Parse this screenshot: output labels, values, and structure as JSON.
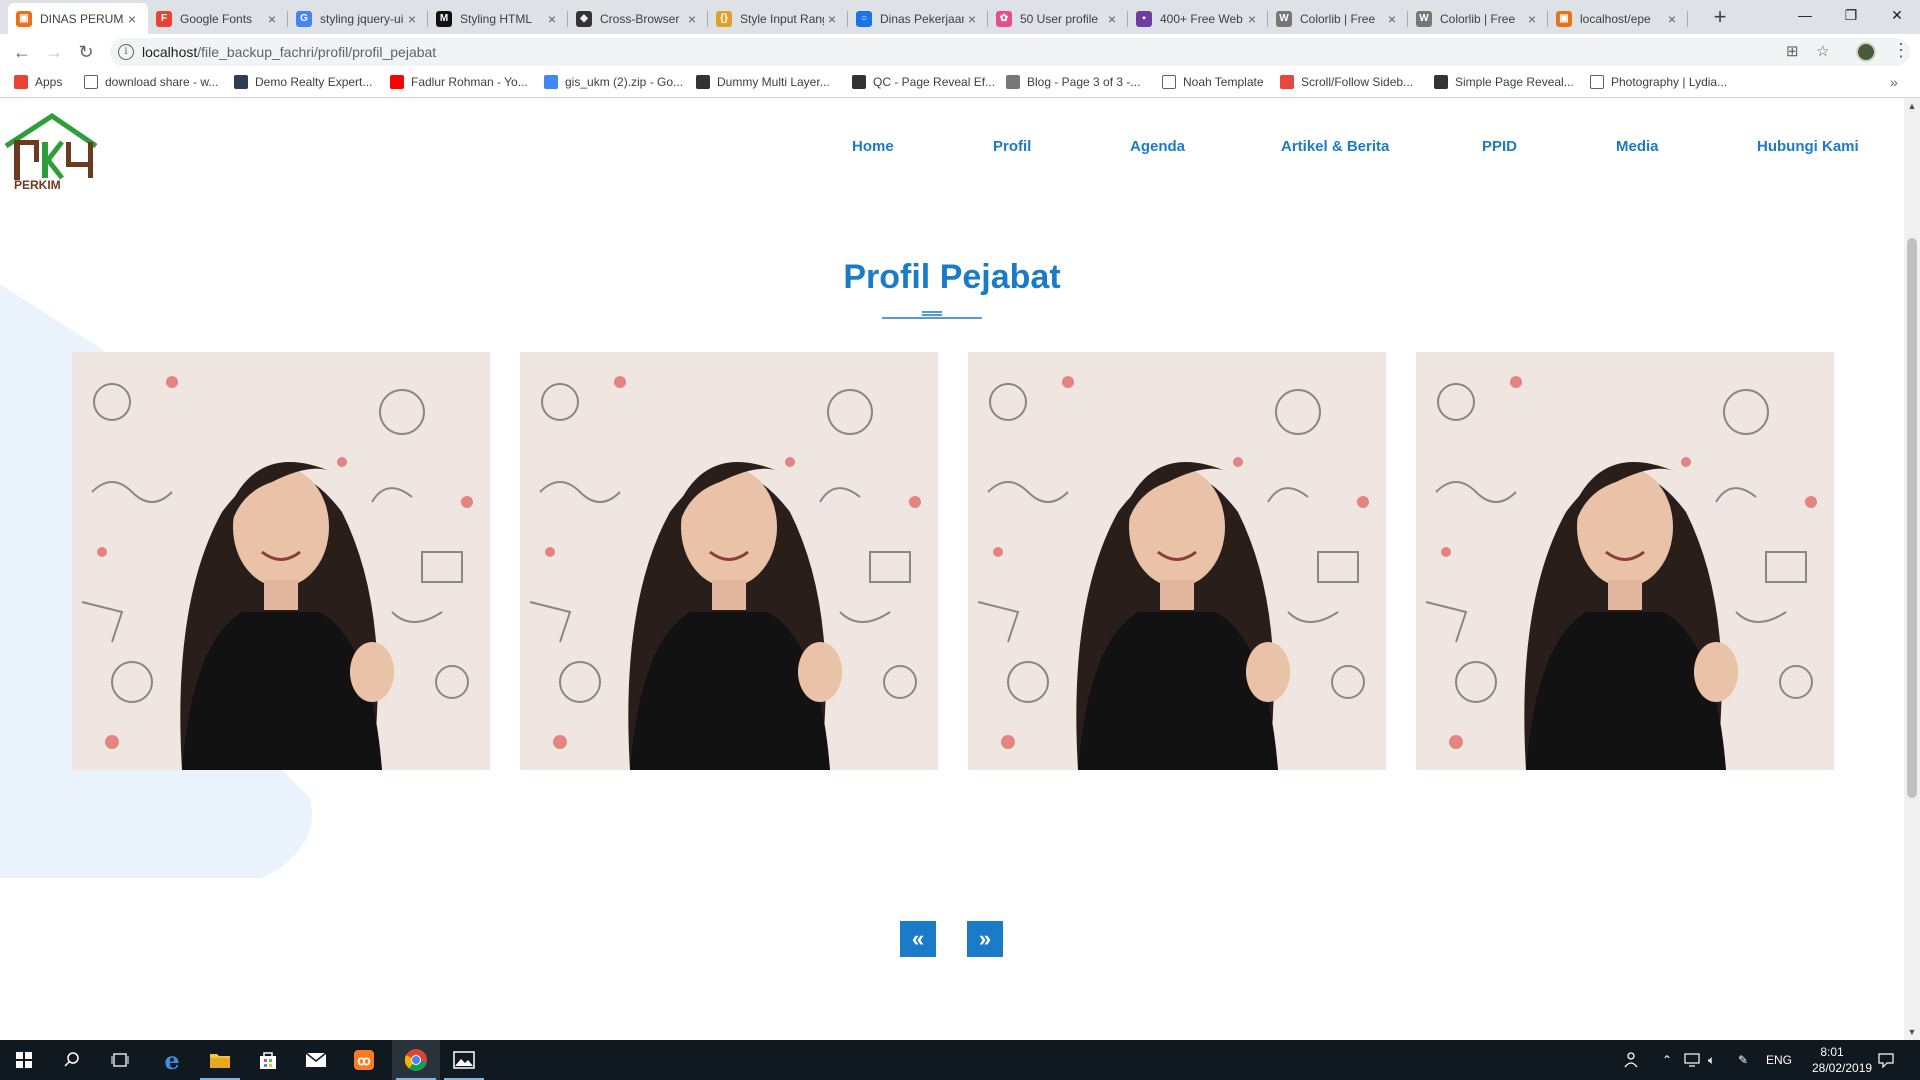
{
  "browser": {
    "tabs": [
      {
        "title": "DINAS PERUMAHAN",
        "active": true,
        "favicon_color": "#e8731a",
        "glyph": "▣"
      },
      {
        "title": "Google Fonts",
        "favicon_color": "#ea4335",
        "glyph": "F"
      },
      {
        "title": "styling jquery-ui",
        "favicon_color": "#4285f4",
        "glyph": "G"
      },
      {
        "title": "Styling HTML",
        "favicon_color": "#111111",
        "glyph": "M"
      },
      {
        "title": "Cross-Browser",
        "favicon_color": "#333333",
        "glyph": "◈"
      },
      {
        "title": "Style Input Range",
        "favicon_color": "#e0a030",
        "glyph": "{}"
      },
      {
        "title": "Dinas Pekerjaan",
        "favicon_color": "#1a73e8",
        "glyph": "○"
      },
      {
        "title": "50 User profile",
        "favicon_color": "#ea4c89",
        "glyph": "✿"
      },
      {
        "title": "400+ Free Web",
        "favicon_color": "#6a3fa0",
        "glyph": "▪"
      },
      {
        "title": "Colorlib | Free",
        "favicon_color": "#777777",
        "glyph": "W"
      },
      {
        "title": "Colorlib | Free",
        "favicon_color": "#777777",
        "glyph": "W"
      },
      {
        "title": "localhost/epe",
        "favicon_color": "#e8731a",
        "glyph": "▣"
      }
    ],
    "new_tab_label": "+",
    "url_host": "localhost",
    "url_path": "/file_backup_fachri/profil/profil_pejabat",
    "bookmarks": [
      {
        "label": "Apps",
        "color": "#ea4335"
      },
      {
        "label": "download share - w...",
        "color": "#ffffff"
      },
      {
        "label": "Demo Realty Expert...",
        "color": "#2c3e50"
      },
      {
        "label": "Fadlur Rohman - Yo...",
        "color": "#ff0000"
      },
      {
        "label": "gis_ukm (2).zip - Go...",
        "color": "#4285f4"
      },
      {
        "label": "Dummy Multi Layer...",
        "color": "#333333"
      },
      {
        "label": "QC - Page Reveal Ef...",
        "color": "#333333"
      },
      {
        "label": "Blog - Page 3 of 3 -...",
        "color": "#777777"
      },
      {
        "label": "Noah Template",
        "color": "#ffffff"
      },
      {
        "label": "Scroll/Follow Sideb...",
        "color": "#e8453c"
      },
      {
        "label": "Simple Page Reveal...",
        "color": "#333333"
      },
      {
        "label": "Photography | Lydia...",
        "color": "#ffffff"
      }
    ],
    "bookmarks_more": "»"
  },
  "site": {
    "logo_text": "PERKIM",
    "nav": [
      "Home",
      "Profil",
      "Agenda",
      "Artikel & Berita",
      "PPID",
      "Media",
      "Hubungi Kami"
    ],
    "page_title": "Profil Pejabat",
    "cards": [
      {
        "alt": "Foto Pejabat 1"
      },
      {
        "alt": "Foto Pejabat 2"
      },
      {
        "alt": "Foto Pejabat 3"
      },
      {
        "alt": "Foto Pejabat 4"
      }
    ],
    "pager": {
      "prev": "«",
      "next": "»"
    },
    "colors": {
      "accent": "#1a7cc9",
      "bg_shape": "#eaf2fb",
      "logo_green": "#2e9e3a",
      "logo_brown": "#6b3a1f"
    }
  },
  "taskbar": {
    "language": "ENG",
    "time": "8:01",
    "date": "28/02/2019"
  }
}
